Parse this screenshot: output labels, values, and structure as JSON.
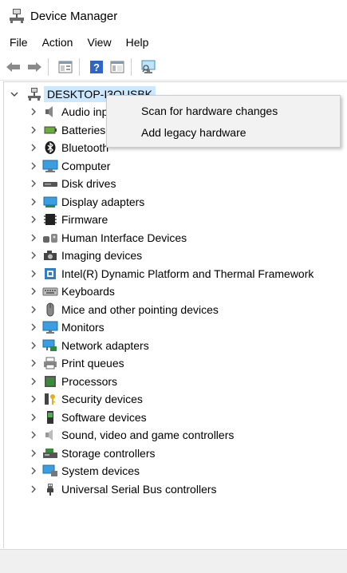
{
  "window": {
    "title": "Device Manager",
    "app_icon": "device-manager-icon"
  },
  "menubar": {
    "items": [
      "File",
      "Action",
      "View",
      "Help"
    ]
  },
  "toolbar": {
    "buttons": [
      "back-arrow-icon",
      "forward-arrow-icon",
      "properties-icon",
      "help-icon",
      "show-hide-console-tree-icon",
      "scan-hardware-icon"
    ]
  },
  "tree": {
    "root": {
      "label": "DESKTOP-I3OUSBK",
      "icon": "computer-root-icon",
      "expanded": true
    },
    "categories": [
      {
        "label": "Audio inputs and outputs",
        "icon": "audio-icon"
      },
      {
        "label": "Batteries",
        "icon": "battery-icon"
      },
      {
        "label": "Bluetooth",
        "icon": "bluetooth-icon"
      },
      {
        "label": "Computer",
        "icon": "computer-icon"
      },
      {
        "label": "Disk drives",
        "icon": "disk-drive-icon"
      },
      {
        "label": "Display adapters",
        "icon": "display-adapter-icon"
      },
      {
        "label": "Firmware",
        "icon": "firmware-icon"
      },
      {
        "label": "Human Interface Devices",
        "icon": "hid-icon"
      },
      {
        "label": "Imaging devices",
        "icon": "camera-icon"
      },
      {
        "label": "Intel(R) Dynamic Platform and Thermal Framework",
        "icon": "chip-icon"
      },
      {
        "label": "Keyboards",
        "icon": "keyboard-icon"
      },
      {
        "label": "Mice and other pointing devices",
        "icon": "mouse-icon"
      },
      {
        "label": "Monitors",
        "icon": "monitor-icon"
      },
      {
        "label": "Network adapters",
        "icon": "network-adapter-icon"
      },
      {
        "label": "Print queues",
        "icon": "printer-icon"
      },
      {
        "label": "Processors",
        "icon": "processor-icon"
      },
      {
        "label": "Security devices",
        "icon": "security-key-icon"
      },
      {
        "label": "Software devices",
        "icon": "software-device-icon"
      },
      {
        "label": "Sound, video and game controllers",
        "icon": "speaker-icon"
      },
      {
        "label": "Storage controllers",
        "icon": "storage-controller-icon"
      },
      {
        "label": "System devices",
        "icon": "system-device-icon"
      },
      {
        "label": "Universal Serial Bus controllers",
        "icon": "usb-icon"
      }
    ]
  },
  "context_menu": {
    "items": [
      "Scan for hardware changes",
      "Add legacy hardware"
    ]
  },
  "colors": {
    "selection": "#cce8ff",
    "menu_bg": "#f2f2f2",
    "accent": "#1e8fd6"
  }
}
